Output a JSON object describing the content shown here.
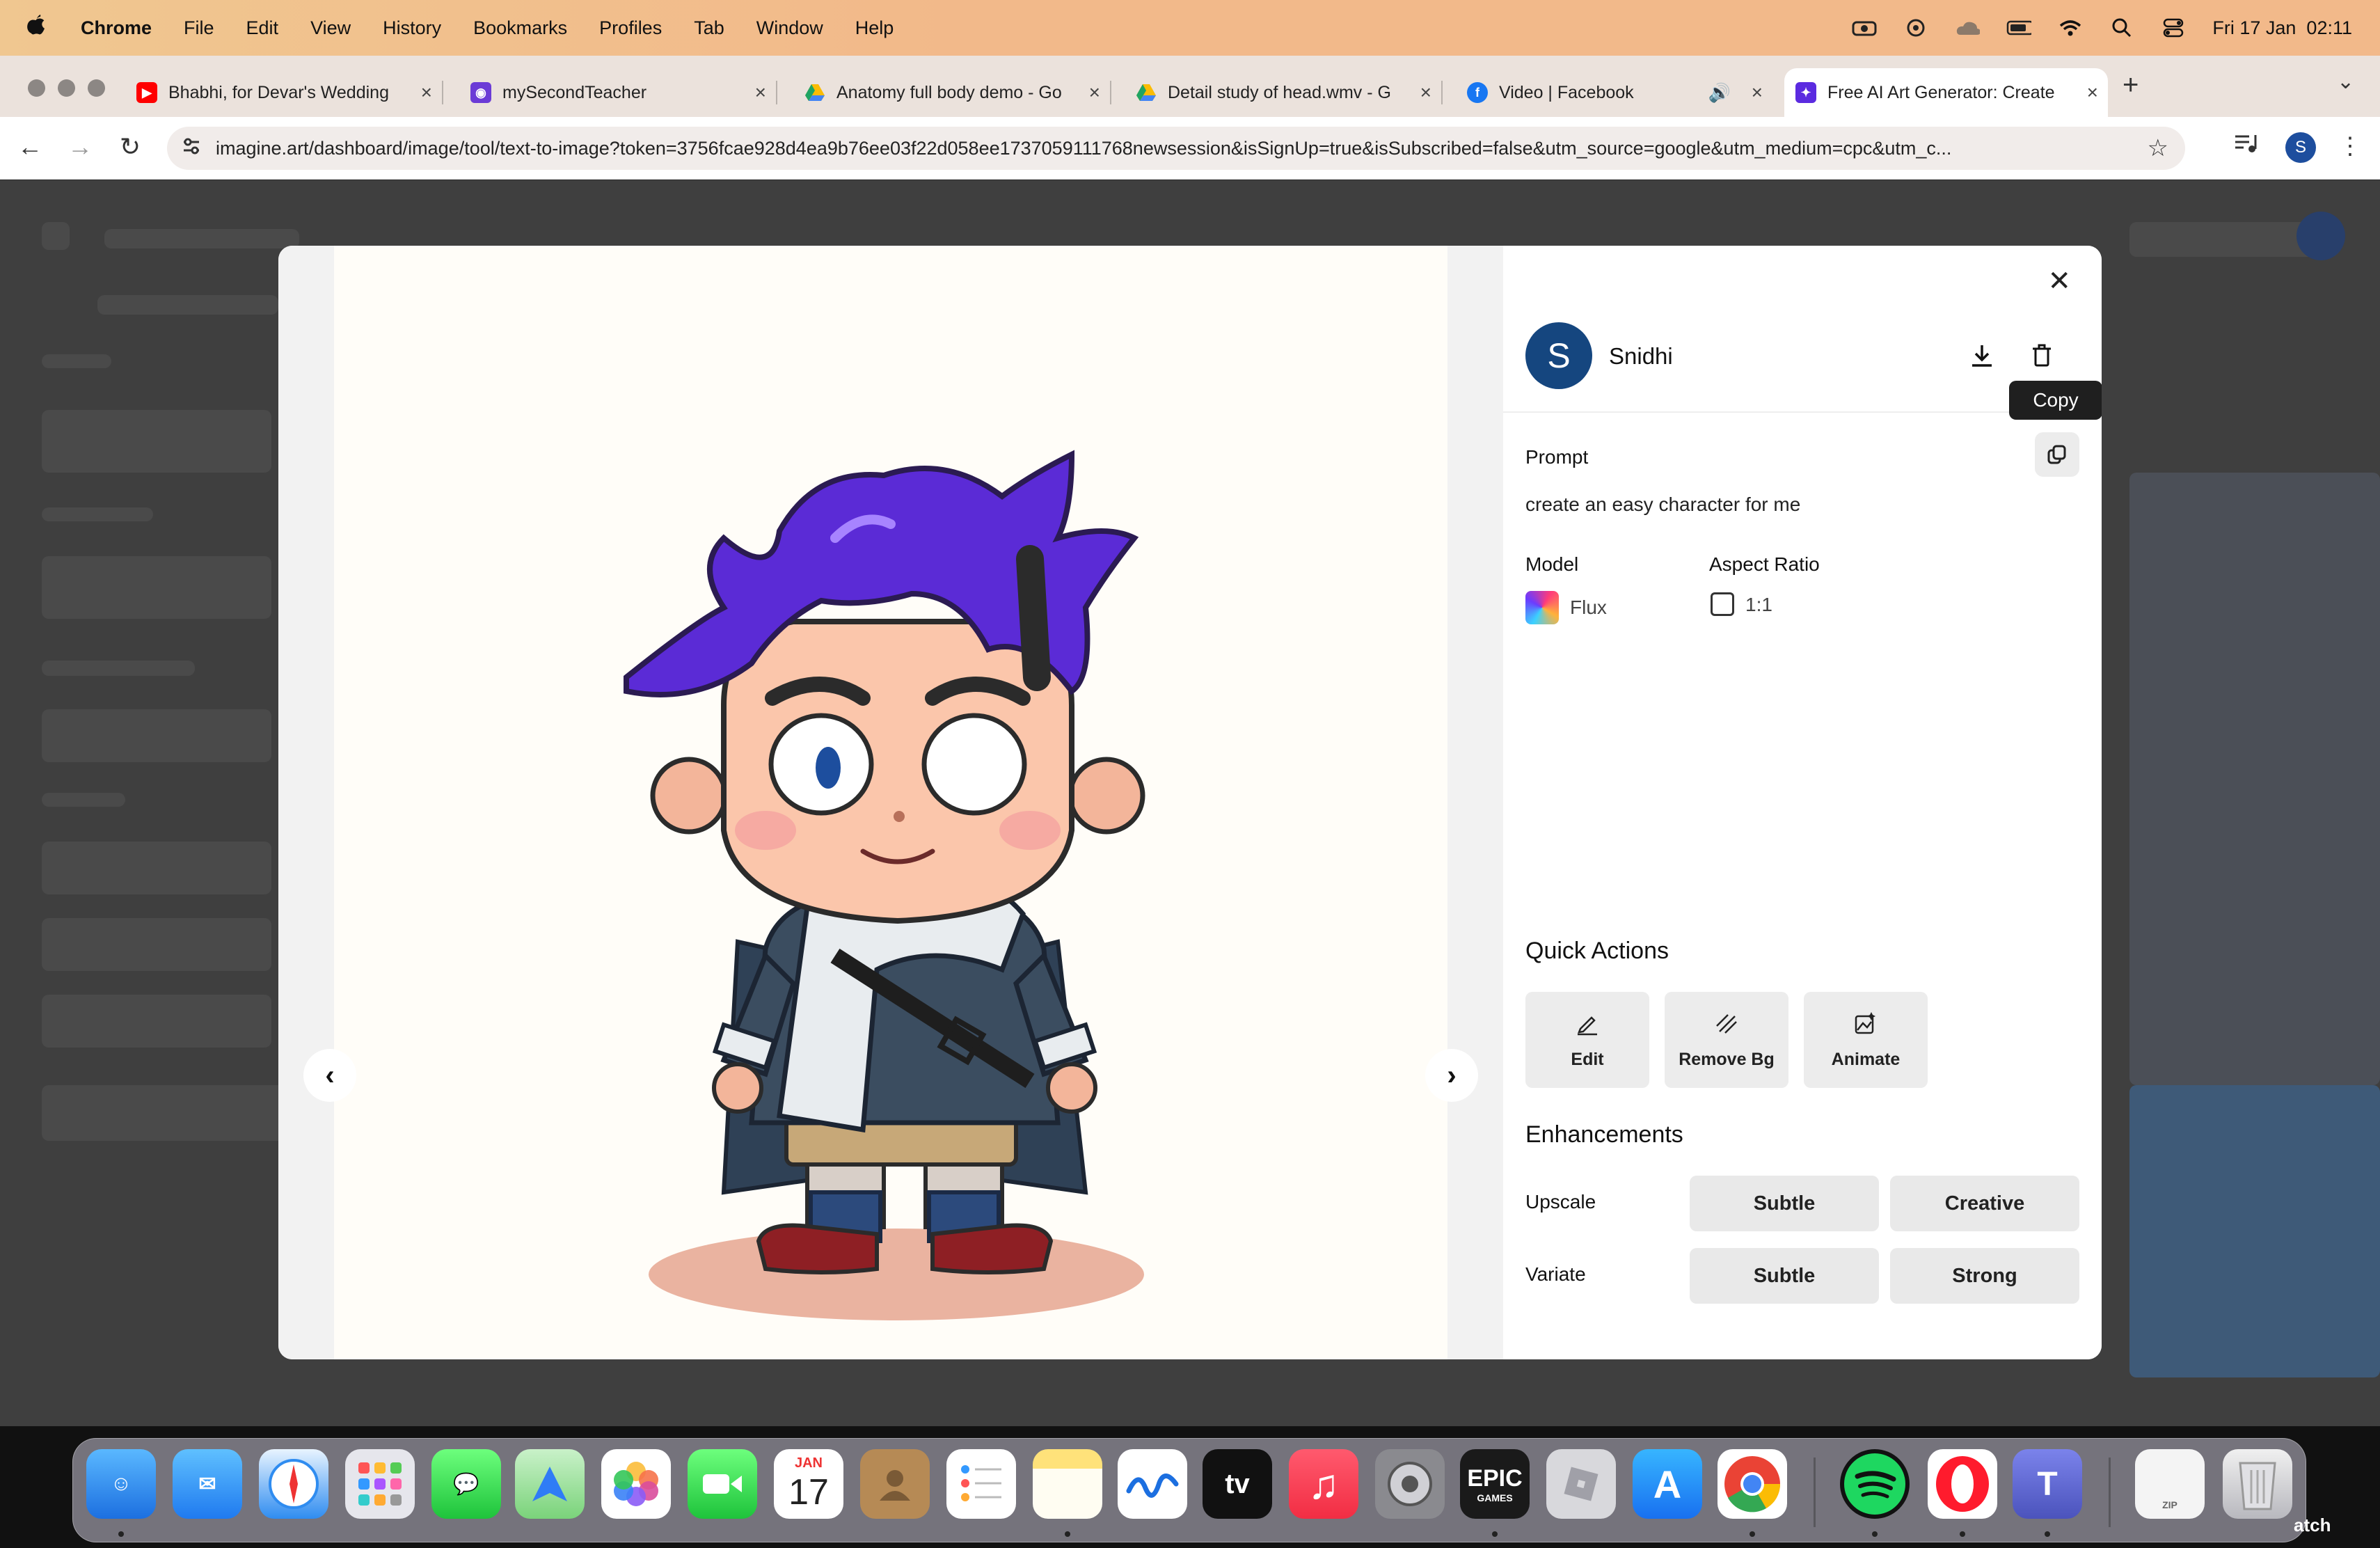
{
  "menubar": {
    "app": "Chrome",
    "items": [
      "File",
      "Edit",
      "View",
      "History",
      "Bookmarks",
      "Profiles",
      "Tab",
      "Window",
      "Help"
    ],
    "datetime": "Fri 17 Jan  02:11"
  },
  "tabs": [
    {
      "title": "Bhabhi, for Devar's Wedding",
      "icon": "youtube-icon",
      "color": "#ff0000"
    },
    {
      "title": "mySecondTeacher",
      "icon": "app-icon",
      "color": "#6b3bd6"
    },
    {
      "title": "Anatomy full body demo - Go",
      "icon": "google-drive-icon",
      "color": "#1fa463"
    },
    {
      "title": "Detail study of head.wmv - G",
      "icon": "google-drive-icon",
      "color": "#1fa463"
    },
    {
      "title": "Video | Facebook",
      "icon": "facebook-icon",
      "color": "#1877f2"
    },
    {
      "title": "Free AI Art Generator: Create",
      "icon": "imagine-icon",
      "color": "#5b2be0"
    }
  ],
  "address": {
    "url": "imagine.art/dashboard/image/tool/text-to-image?token=3756fcae928d4ea9b76ee03f22d058ee1737059111768newsession&isSignUp=true&isSubscribed=false&utm_source=google&utm_medium=cpc&utm_c..."
  },
  "profile": {
    "initial": "S"
  },
  "modal": {
    "user": {
      "initial": "S",
      "name": "Snidhi"
    },
    "tooltip": "Copy",
    "prompt_label": "Prompt",
    "prompt_text": "create an easy character for me",
    "model_label": "Model",
    "model_value": "Flux",
    "aspect_label": "Aspect Ratio",
    "aspect_value": "1:1",
    "quick_actions_title": "Quick Actions",
    "quick_actions": [
      "Edit",
      "Remove Bg",
      "Animate"
    ],
    "enhancements_title": "Enhancements",
    "upscale_label": "Upscale",
    "upscale_options": [
      "Subtle",
      "Creative"
    ],
    "variate_label": "Variate",
    "variate_options": [
      "Subtle",
      "Strong"
    ]
  },
  "dock": {
    "apps": [
      "Finder",
      "Mail",
      "Safari",
      "Launchpad",
      "Messages",
      "Maps",
      "Photos",
      "FaceTime",
      "Calendar",
      "Contacts",
      "Reminders",
      "Notes",
      "Freeform",
      "TV",
      "Music",
      "System Settings",
      "Epic Games",
      "Roblox",
      "App Store",
      "Chrome",
      "Spotify",
      "Opera",
      "Teams",
      "Archive",
      "Trash"
    ],
    "calendar_month": "JAN",
    "calendar_day": "17",
    "tv_label": "tv",
    "epic_label": "EPIC",
    "epic_sub": "GAMES",
    "archive_label": "ZIP",
    "corner_text": "atch"
  }
}
